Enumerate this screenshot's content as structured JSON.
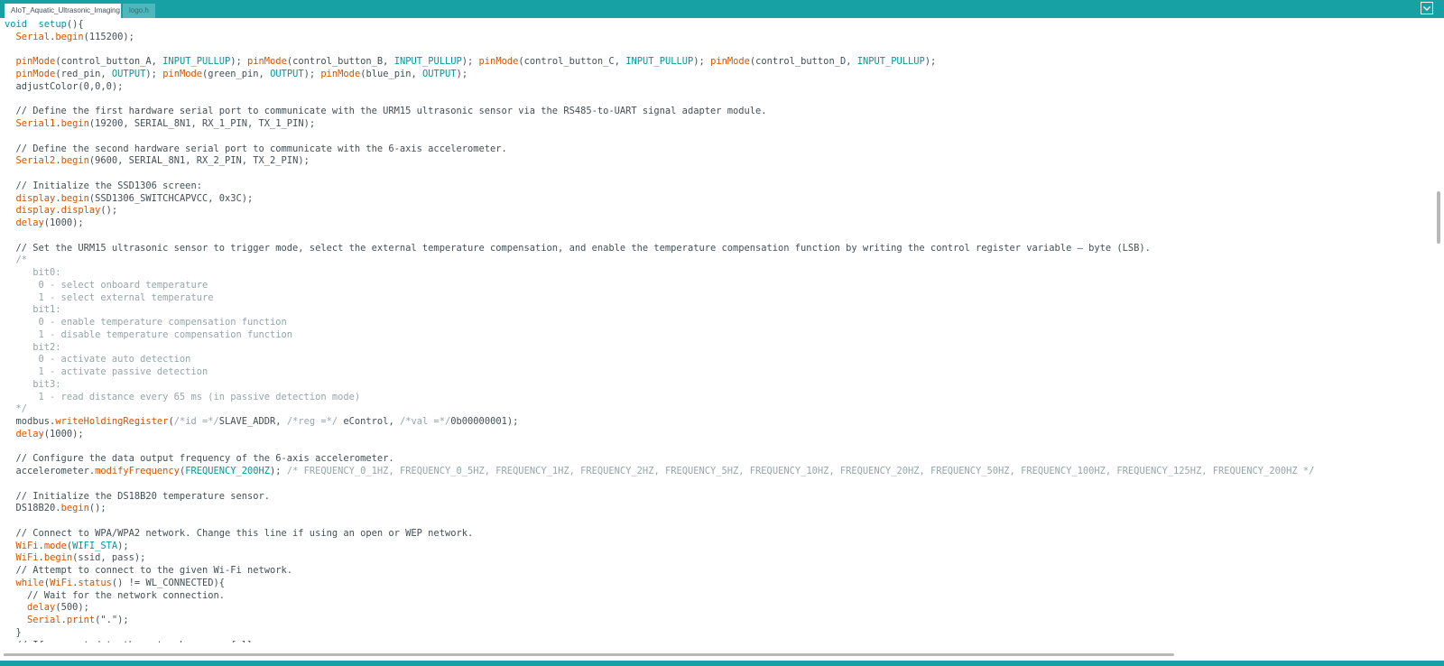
{
  "colors": {
    "accent": "#17a1a5",
    "keyword": "#00979c",
    "function": "#d35400",
    "text": "#434f54",
    "block_comment": "#95a5a6"
  },
  "tabs": [
    {
      "label": "AIoT_Aquatic_Ultrasonic_Imaging",
      "active": true
    },
    {
      "label": "logo.h",
      "active": false
    }
  ],
  "tab_menu_icon": "chevron-down-icon",
  "code_lines": [
    [
      [
        "kw",
        "void"
      ],
      [
        "",
        "  "
      ],
      [
        "kw",
        "setup"
      ],
      [
        "",
        "(){"
      ]
    ],
    [
      [
        "",
        "  "
      ],
      [
        "fn",
        "Serial"
      ],
      [
        "",
        "."
      ],
      [
        "fn",
        "begin"
      ],
      [
        "",
        "(115200);"
      ]
    ],
    [],
    [
      [
        "",
        "  "
      ],
      [
        "fn",
        "pinMode"
      ],
      [
        "",
        "(control_button_A, "
      ],
      [
        "ty",
        "INPUT_PULLUP"
      ],
      [
        "",
        "); "
      ],
      [
        "fn",
        "pinMode"
      ],
      [
        "",
        "(control_button_B, "
      ],
      [
        "ty",
        "INPUT_PULLUP"
      ],
      [
        "",
        "); "
      ],
      [
        "fn",
        "pinMode"
      ],
      [
        "",
        "(control_button_C, "
      ],
      [
        "ty",
        "INPUT_PULLUP"
      ],
      [
        "",
        "); "
      ],
      [
        "fn",
        "pinMode"
      ],
      [
        "",
        "(control_button_D, "
      ],
      [
        "ty",
        "INPUT_PULLUP"
      ],
      [
        "",
        ");"
      ]
    ],
    [
      [
        "",
        "  "
      ],
      [
        "fn",
        "pinMode"
      ],
      [
        "",
        "(red_pin, "
      ],
      [
        "ty",
        "OUTPUT"
      ],
      [
        "",
        "); "
      ],
      [
        "fn",
        "pinMode"
      ],
      [
        "",
        "(green_pin, "
      ],
      [
        "ty",
        "OUTPUT"
      ],
      [
        "",
        "); "
      ],
      [
        "fn",
        "pinMode"
      ],
      [
        "",
        "(blue_pin, "
      ],
      [
        "ty",
        "OUTPUT"
      ],
      [
        "",
        ");"
      ]
    ],
    [
      [
        "",
        "  adjustColor(0,0,0);"
      ]
    ],
    [],
    [
      [
        "cm",
        "  // Define the first hardware serial port to communicate with the URM15 ultrasonic sensor via the RS485-to-UART signal adapter module."
      ]
    ],
    [
      [
        "",
        "  "
      ],
      [
        "fn",
        "Serial1"
      ],
      [
        "",
        "."
      ],
      [
        "fn",
        "begin"
      ],
      [
        "",
        "(19200, SERIAL_8N1, RX_1_PIN, TX_1_PIN);"
      ]
    ],
    [],
    [
      [
        "cm",
        "  // Define the second hardware serial port to communicate with the 6-axis accelerometer."
      ]
    ],
    [
      [
        "",
        "  "
      ],
      [
        "fn",
        "Serial2"
      ],
      [
        "",
        "."
      ],
      [
        "fn",
        "begin"
      ],
      [
        "",
        "(9600, SERIAL_8N1, RX_2_PIN, TX_2_PIN);"
      ]
    ],
    [],
    [
      [
        "cm",
        "  // Initialize the SSD1306 screen:"
      ]
    ],
    [
      [
        "",
        "  "
      ],
      [
        "fn",
        "display"
      ],
      [
        "",
        "."
      ],
      [
        "fn",
        "begin"
      ],
      [
        "",
        "(SSD1306_SWITCHCAPVCC, 0x3C);"
      ]
    ],
    [
      [
        "",
        "  "
      ],
      [
        "fn",
        "display"
      ],
      [
        "",
        "."
      ],
      [
        "fn",
        "display"
      ],
      [
        "",
        "();"
      ]
    ],
    [
      [
        "",
        "  "
      ],
      [
        "fn",
        "delay"
      ],
      [
        "",
        "(1000);"
      ]
    ],
    [],
    [
      [
        "cm",
        "  // Set the URM15 ultrasonic sensor to trigger mode, select the external temperature compensation, and enable the temperature compensation function by writing the control register variable — byte (LSB)."
      ]
    ],
    [
      [
        "bc",
        "  /*"
      ]
    ],
    [
      [
        "bc",
        "     bit0:"
      ]
    ],
    [
      [
        "bc",
        "      0 - select onboard temperature"
      ]
    ],
    [
      [
        "bc",
        "      1 - select external temperature"
      ]
    ],
    [
      [
        "bc",
        "     bit1:"
      ]
    ],
    [
      [
        "bc",
        "      0 - enable temperature compensation function"
      ]
    ],
    [
      [
        "bc",
        "      1 - disable temperature compensation function"
      ]
    ],
    [
      [
        "bc",
        "     bit2:"
      ]
    ],
    [
      [
        "bc",
        "      0 - activate auto detection"
      ]
    ],
    [
      [
        "bc",
        "      1 - activate passive detection"
      ]
    ],
    [
      [
        "bc",
        "     bit3:"
      ]
    ],
    [
      [
        "bc",
        "      1 - read distance every 65 ms (in passive detection mode)"
      ]
    ],
    [
      [
        "bc",
        "  */"
      ]
    ],
    [
      [
        "",
        "  modbus."
      ],
      [
        "fn",
        "writeHoldingRegister"
      ],
      [
        "",
        "("
      ],
      [
        "bc",
        "/*id =*/"
      ],
      [
        "",
        "SLAVE_ADDR, "
      ],
      [
        "bc",
        "/*reg =*/"
      ],
      [
        "",
        " eControl, "
      ],
      [
        "bc",
        "/*val =*/"
      ],
      [
        "",
        "0b00000001);"
      ]
    ],
    [
      [
        "",
        "  "
      ],
      [
        "fn",
        "delay"
      ],
      [
        "",
        "(1000);"
      ]
    ],
    [],
    [
      [
        "cm",
        "  // Configure the data output frequency of the 6-axis accelerometer."
      ]
    ],
    [
      [
        "",
        "  accelerometer."
      ],
      [
        "fn",
        "modifyFrequency"
      ],
      [
        "",
        "("
      ],
      [
        "ty",
        "FREQUENCY_200HZ"
      ],
      [
        "",
        "); "
      ],
      [
        "bc",
        "/* FREQUENCY_0_1HZ, FREQUENCY_0_5HZ, FREQUENCY_1HZ, FREQUENCY_2HZ, FREQUENCY_5HZ, FREQUENCY_10HZ, FREQUENCY_20HZ, FREQUENCY_50HZ, FREQUENCY_100HZ, FREQUENCY_125HZ, FREQUENCY_200HZ */"
      ]
    ],
    [],
    [
      [
        "cm",
        "  // Initialize the DS18B20 temperature sensor."
      ]
    ],
    [
      [
        "",
        "  DS18B20."
      ],
      [
        "fn",
        "begin"
      ],
      [
        "",
        "();"
      ]
    ],
    [],
    [
      [
        "cm",
        "  // Connect to WPA/WPA2 network. Change this line if using an open or WEP network."
      ]
    ],
    [
      [
        "",
        "  "
      ],
      [
        "fn",
        "WiFi"
      ],
      [
        "",
        "."
      ],
      [
        "fn",
        "mode"
      ],
      [
        "",
        "("
      ],
      [
        "ty",
        "WIFI_STA"
      ],
      [
        "",
        ");"
      ]
    ],
    [
      [
        "",
        "  "
      ],
      [
        "fn",
        "WiFi"
      ],
      [
        "",
        "."
      ],
      [
        "fn",
        "begin"
      ],
      [
        "",
        "(ssid, pass);"
      ]
    ],
    [
      [
        "cm",
        "  // Attempt to connect to the given Wi-Fi network."
      ]
    ],
    [
      [
        "",
        "  "
      ],
      [
        "fn",
        "while"
      ],
      [
        "",
        "("
      ],
      [
        "fn",
        "WiFi"
      ],
      [
        "",
        "."
      ],
      [
        "fn",
        "status"
      ],
      [
        "",
        "() != WL_CONNECTED){"
      ]
    ],
    [
      [
        "cm",
        "    // Wait for the network connection."
      ]
    ],
    [
      [
        "",
        "    "
      ],
      [
        "fn",
        "delay"
      ],
      [
        "",
        "(500);"
      ]
    ],
    [
      [
        "",
        "    "
      ],
      [
        "fn",
        "Serial"
      ],
      [
        "",
        "."
      ],
      [
        "fn",
        "print"
      ],
      [
        "",
        "(\".\");"
      ]
    ],
    [
      [
        "",
        "  }"
      ]
    ],
    [
      [
        "cm",
        "  // If connected to the network successfully:"
      ]
    ]
  ]
}
